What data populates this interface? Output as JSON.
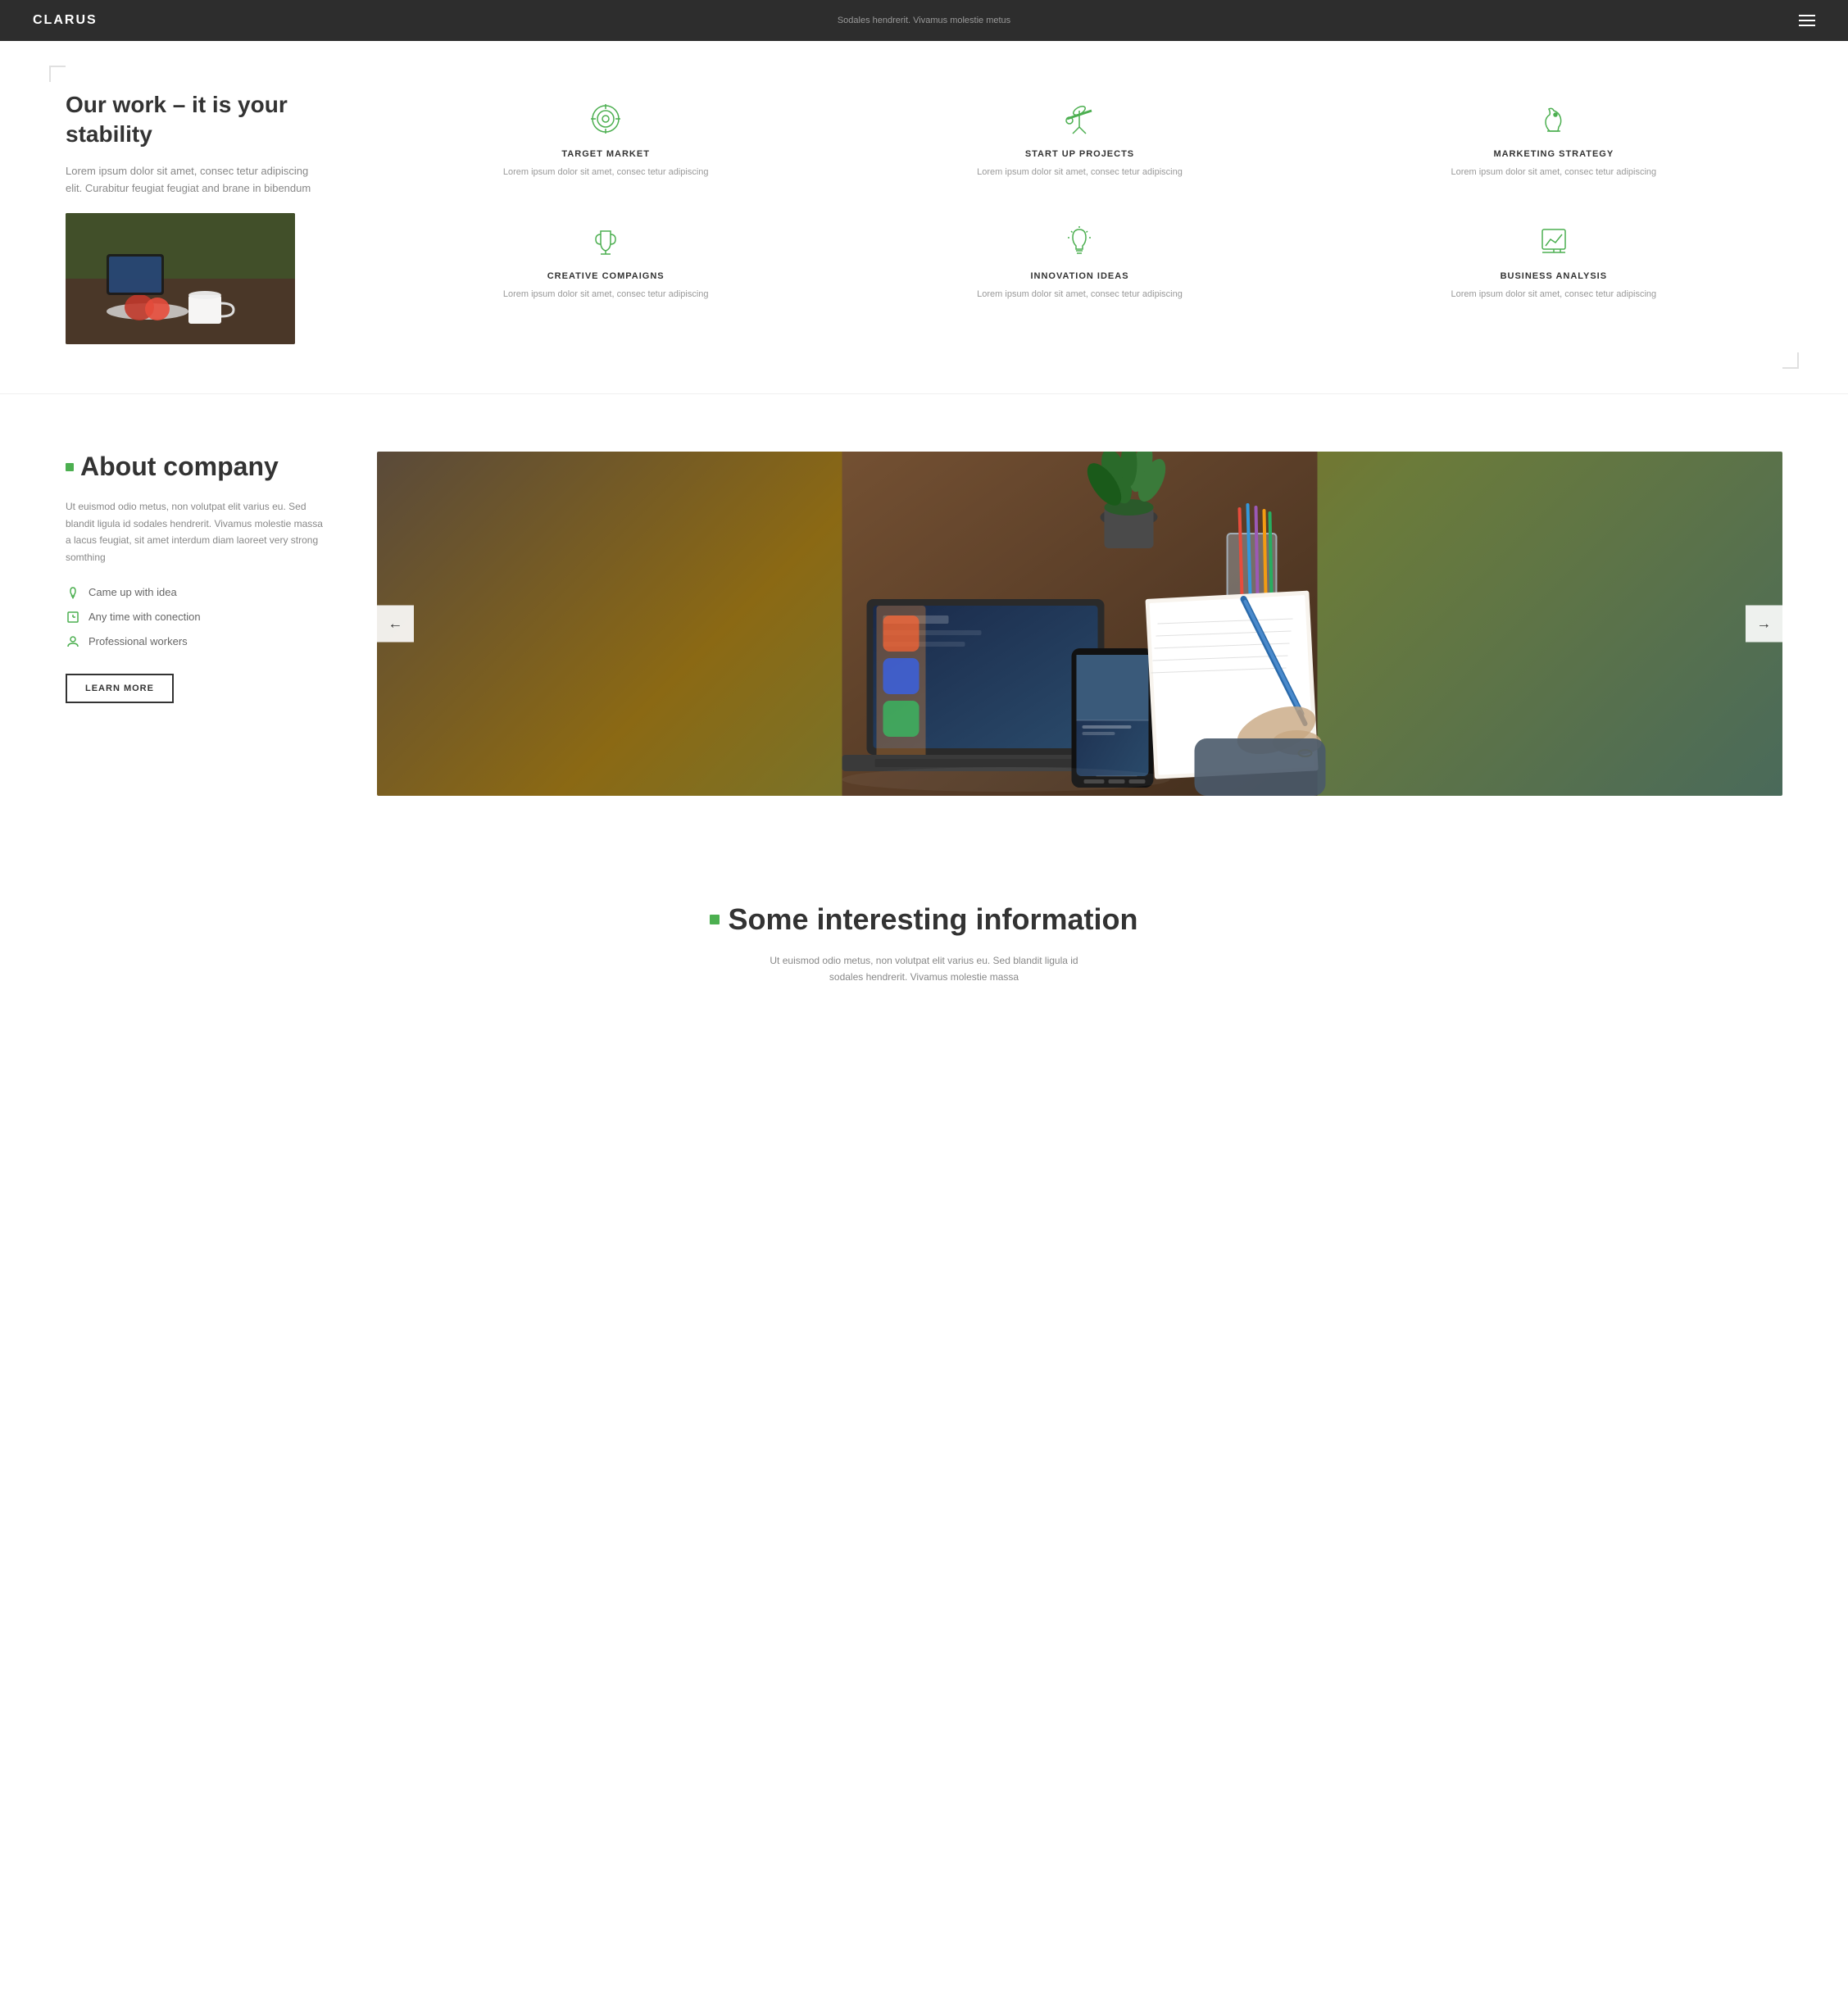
{
  "nav": {
    "logo": "CLARUS",
    "subtitle": "Sodales hendrerit. Vivamus molestie metus"
  },
  "work_section": {
    "heading": "Our work – it is your stability",
    "description": "Lorem ipsum dolor sit amet, consec tetur adipiscing elit. Curabitur feugiat feugiat and brane in bibendum",
    "features": [
      {
        "id": "target-market",
        "title": "TARGET MARKET",
        "description": "Lorem ipsum dolor sit amet, consec tetur adipiscing",
        "icon": "target"
      },
      {
        "id": "startup-projects",
        "title": "START UP PROJECTS",
        "description": "Lorem ipsum dolor sit amet, consec tetur adipiscing",
        "icon": "telescope"
      },
      {
        "id": "marketing-strategy",
        "title": "MARKETING STRATEGY",
        "description": "Lorem ipsum dolor sit amet, consec tetur adipiscing",
        "icon": "horse"
      },
      {
        "id": "creative-campaigns",
        "title": "CREATIVE COMPAIGNS",
        "description": "Lorem ipsum dolor sit amet, consec tetur adipiscing",
        "icon": "trophy"
      },
      {
        "id": "innovation-ideas",
        "title": "INNOVATION IDEAS",
        "description": "Lorem ipsum dolor sit amet, consec tetur adipiscing",
        "icon": "lightbulb"
      },
      {
        "id": "business-analysis",
        "title": "BUSINESS ANALYSIS",
        "description": "Lorem ipsum dolor sit amet, consec tetur adipiscing",
        "icon": "chart"
      }
    ]
  },
  "about_section": {
    "heading": "About company",
    "description": "Ut euismod odio metus, non volutpat elit varius eu. Sed blandit ligula id sodales hendrerit. Vivamus molestie massa a lacus feugiat, sit amet interdum diam laoreet very strong somthing",
    "features": [
      {
        "id": "idea",
        "text": "Came up with idea",
        "icon": "lightbulb"
      },
      {
        "id": "time",
        "text": "Any time with conection",
        "icon": "clock"
      },
      {
        "id": "workers",
        "text": "Professional workers",
        "icon": "user"
      }
    ],
    "button_label": "LEARN MORE",
    "arrow_left": "←",
    "arrow_right": "→"
  },
  "info_section": {
    "heading": "Some interesting information",
    "description": "Ut euismod odio metus, non volutpat elit varius eu. Sed blandit ligula id sodales hendrerit. Vivamus molestie massa"
  }
}
